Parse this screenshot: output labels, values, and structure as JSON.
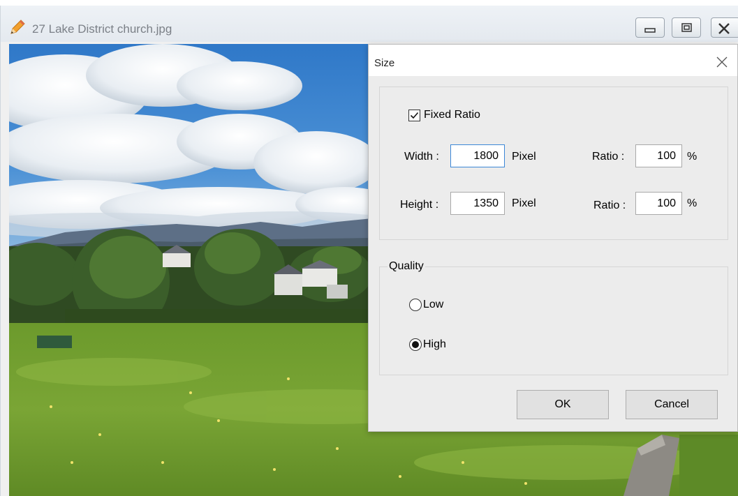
{
  "window": {
    "title": "27 Lake District church.jpg",
    "icon": "pencil-icon",
    "controls": [
      "minimize-icon",
      "maximize-icon",
      "close-icon"
    ]
  },
  "dialog": {
    "title": "Size",
    "fixed_ratio": {
      "label": "Fixed Ratio",
      "checked": true
    },
    "width": {
      "label": "Width :",
      "value": "1800",
      "unit": "Pixel",
      "ratio_label": "Ratio :",
      "ratio_value": "100",
      "ratio_unit": "%"
    },
    "height": {
      "label": "Height :",
      "value": "1350",
      "unit": "Pixel",
      "ratio_label": "Ratio :",
      "ratio_value": "100",
      "ratio_unit": "%"
    },
    "quality": {
      "legend": "Quality",
      "options": [
        {
          "label": "Low",
          "selected": false
        },
        {
          "label": "High",
          "selected": true
        }
      ]
    },
    "ok_label": "OK",
    "cancel_label": "Cancel"
  }
}
